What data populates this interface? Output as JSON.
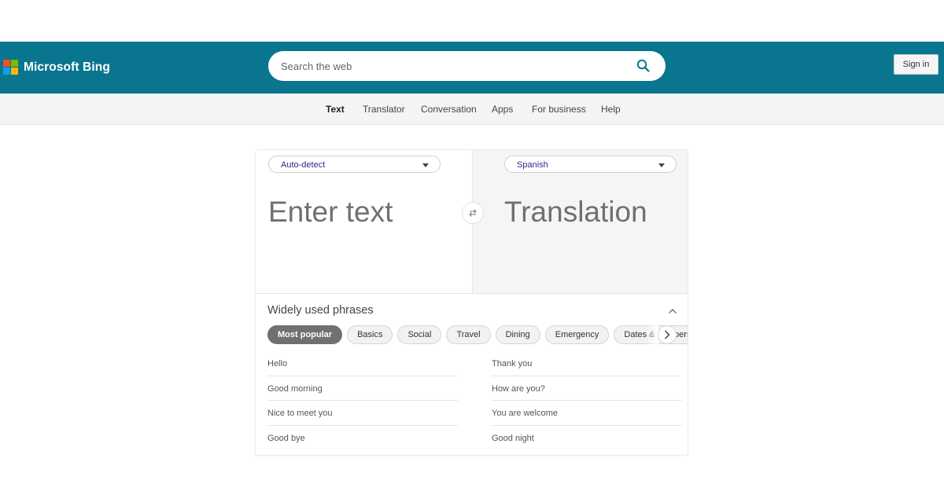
{
  "header": {
    "brand": "Microsoft Bing",
    "brand_colors": [
      "#f25022",
      "#7fba00",
      "#00a4ef",
      "#ffb900"
    ],
    "bar_color": "#0a758f",
    "search": {
      "placeholder": "Search the web",
      "icon": "search-icon"
    },
    "sign_in_label": "Sign in"
  },
  "subnav": {
    "items": [
      {
        "label": "Text",
        "active": true
      },
      {
        "label": "Translator"
      },
      {
        "label": "Conversation"
      },
      {
        "label": "Apps"
      },
      {
        "label": "For business"
      },
      {
        "label": "Help"
      }
    ]
  },
  "translator": {
    "source_lang": "Auto-detect",
    "target_lang": "Spanish",
    "source_placeholder": "Enter text",
    "target_placeholder": "Translation",
    "swap_icon": "swap-arrows-icon"
  },
  "phrases": {
    "title": "Widely used phrases",
    "categories": [
      "Most popular",
      "Basics",
      "Social",
      "Travel",
      "Dining",
      "Emergency",
      "Dates & numbers"
    ],
    "active_category": "Most popular",
    "left_column": [
      "Hello",
      "Good morning",
      "Nice to meet you",
      "Good bye"
    ],
    "right_column": [
      "Thank you",
      "How are you?",
      "You are welcome",
      "Good night"
    ]
  }
}
